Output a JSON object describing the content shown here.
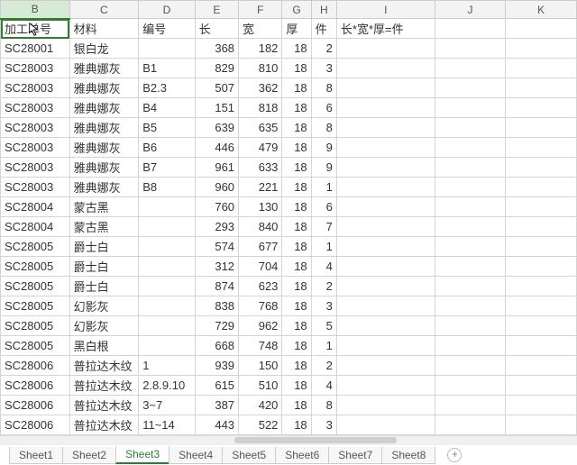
{
  "columns": [
    "B",
    "C",
    "D",
    "E",
    "F",
    "G",
    "H",
    "I",
    "J",
    "K"
  ],
  "selected_column": "B",
  "headers": {
    "B": "加工单号",
    "C": "材料",
    "D": "编号",
    "E": "长",
    "F": "宽",
    "G": "厚",
    "H": "件",
    "I": "长*宽*厚=件"
  },
  "rows": [
    {
      "B": "SC28001",
      "C": "银白龙",
      "D": "",
      "E": "368",
      "F": "182",
      "G": "18",
      "H": "2",
      "I": ""
    },
    {
      "B": "SC28003",
      "C": "雅典娜灰",
      "D": "B1",
      "E": "829",
      "F": "810",
      "G": "18",
      "H": "3",
      "I": ""
    },
    {
      "B": "SC28003",
      "C": "雅典娜灰",
      "D": "B2.3",
      "E": "507",
      "F": "362",
      "G": "18",
      "H": "8",
      "I": ""
    },
    {
      "B": "SC28003",
      "C": "雅典娜灰",
      "D": "B4",
      "E": "151",
      "F": "818",
      "G": "18",
      "H": "6",
      "I": ""
    },
    {
      "B": "SC28003",
      "C": "雅典娜灰",
      "D": "B5",
      "E": "639",
      "F": "635",
      "G": "18",
      "H": "8",
      "I": ""
    },
    {
      "B": "SC28003",
      "C": "雅典娜灰",
      "D": "B6",
      "E": "446",
      "F": "479",
      "G": "18",
      "H": "9",
      "I": ""
    },
    {
      "B": "SC28003",
      "C": "雅典娜灰",
      "D": "B7",
      "E": "961",
      "F": "633",
      "G": "18",
      "H": "9",
      "I": ""
    },
    {
      "B": "SC28003",
      "C": "雅典娜灰",
      "D": "B8",
      "E": "960",
      "F": "221",
      "G": "18",
      "H": "1",
      "I": ""
    },
    {
      "B": "SC28004",
      "C": "蒙古黑",
      "D": "",
      "E": "760",
      "F": "130",
      "G": "18",
      "H": "6",
      "I": ""
    },
    {
      "B": "SC28004",
      "C": "蒙古黑",
      "D": "",
      "E": "293",
      "F": "840",
      "G": "18",
      "H": "7",
      "I": ""
    },
    {
      "B": "SC28005",
      "C": "爵士白",
      "D": "",
      "E": "574",
      "F": "677",
      "G": "18",
      "H": "1",
      "I": ""
    },
    {
      "B": "SC28005",
      "C": "爵士白",
      "D": "",
      "E": "312",
      "F": "704",
      "G": "18",
      "H": "4",
      "I": ""
    },
    {
      "B": "SC28005",
      "C": "爵士白",
      "D": "",
      "E": "874",
      "F": "623",
      "G": "18",
      "H": "2",
      "I": ""
    },
    {
      "B": "SC28005",
      "C": "幻影灰",
      "D": "",
      "E": "838",
      "F": "768",
      "G": "18",
      "H": "3",
      "I": ""
    },
    {
      "B": "SC28005",
      "C": "幻影灰",
      "D": "",
      "E": "729",
      "F": "962",
      "G": "18",
      "H": "5",
      "I": ""
    },
    {
      "B": "SC28005",
      "C": "黑白根",
      "D": "",
      "E": "668",
      "F": "748",
      "G": "18",
      "H": "1",
      "I": ""
    },
    {
      "B": "SC28006",
      "C": "普拉达木纹",
      "D": "1",
      "E": "939",
      "F": "150",
      "G": "18",
      "H": "2",
      "I": ""
    },
    {
      "B": "SC28006",
      "C": "普拉达木纹",
      "D": "2.8.9.10",
      "E": "615",
      "F": "510",
      "G": "18",
      "H": "4",
      "I": ""
    },
    {
      "B": "SC28006",
      "C": "普拉达木纹",
      "D": "3~7",
      "E": "387",
      "F": "420",
      "G": "18",
      "H": "8",
      "I": ""
    },
    {
      "B": "SC28006",
      "C": "普拉达木纹",
      "D": "11~14",
      "E": "443",
      "F": "522",
      "G": "18",
      "H": "3",
      "I": ""
    }
  ],
  "sheets": [
    "Sheet1",
    "Sheet2",
    "Sheet3",
    "Sheet4",
    "Sheet5",
    "Sheet6",
    "Sheet7",
    "Sheet8"
  ],
  "active_sheet": "Sheet3",
  "add_tab_label": "+"
}
